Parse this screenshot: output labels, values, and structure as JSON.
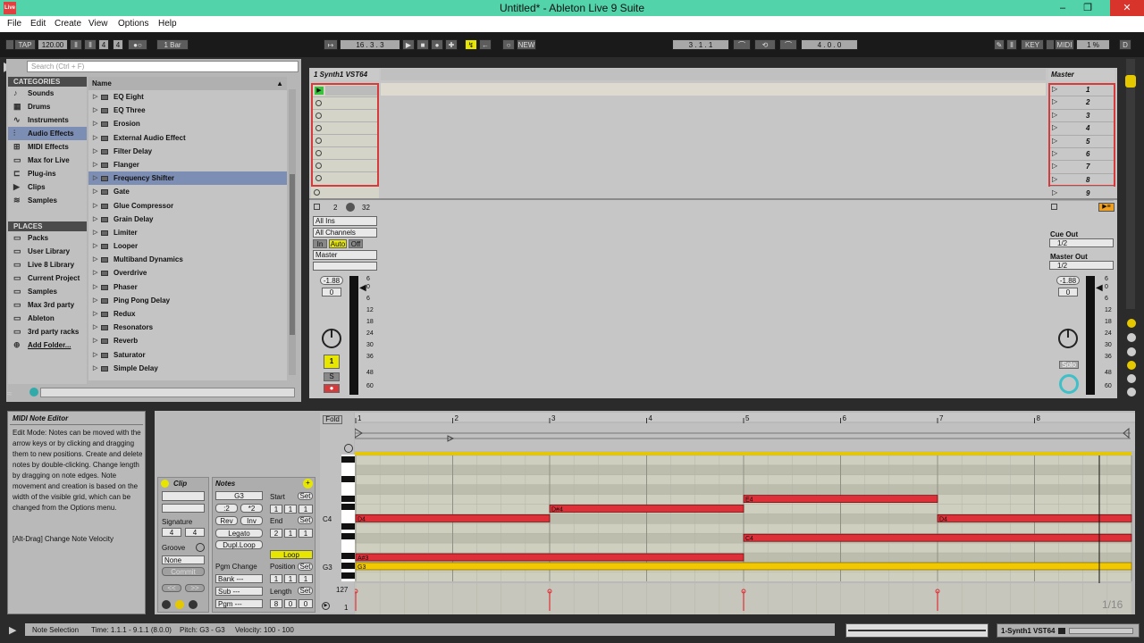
{
  "window": {
    "title": "Untitled* - Ableton Live 9 Suite",
    "icon_text": "Live"
  },
  "menu": [
    "File",
    "Edit",
    "Create",
    "View",
    "Options",
    "Help"
  ],
  "toolbar": {
    "tap": "TAP",
    "tempo": "120.00",
    "sig_num": "4",
    "sig_den": "4",
    "quant": "1 Bar",
    "position": "16 . 3 . 3",
    "new": "NEW",
    "loop_start": "3 . 1 . 1",
    "loop_len": "4 . 0 . 0",
    "key": "KEY",
    "midi": "MIDI",
    "cpu": "1 %",
    "d": "D"
  },
  "browser": {
    "search_placeholder": "Search (Ctrl + F)",
    "categories_title": "CATEGORIES",
    "categories": [
      "Sounds",
      "Drums",
      "Instruments",
      "Audio Effects",
      "MIDI Effects",
      "Max for Live",
      "Plug-ins",
      "Clips",
      "Samples"
    ],
    "places_title": "PLACES",
    "places": [
      "Packs",
      "User Library",
      "Live 8 Library",
      "Current Project",
      "Samples",
      "Max 3rd party",
      "Ableton",
      "3rd party racks",
      "Add Folder..."
    ],
    "name_header": "Name",
    "items": [
      "EQ Eight",
      "EQ Three",
      "Erosion",
      "External Audio Effect",
      "Filter Delay",
      "Flanger",
      "Frequency Shifter",
      "Gate",
      "Glue Compressor",
      "Grain Delay",
      "Limiter",
      "Looper",
      "Multiband Dynamics",
      "Overdrive",
      "Phaser",
      "Ping Pong Delay",
      "Redux",
      "Resonators",
      "Reverb",
      "Saturator",
      "Simple Delay"
    ]
  },
  "track": {
    "name": "1 Synth1 VST64",
    "num_a": "2",
    "num_b": "32",
    "input_type": "All Ins",
    "input_channel": "All Channels",
    "mon_in": "In",
    "mon_auto": "Auto",
    "mon_off": "Off",
    "output": "Master",
    "volume": "-1.88",
    "pan": "0",
    "track_num": "1",
    "solo": "S"
  },
  "master": {
    "name": "Master",
    "scenes": [
      "1",
      "2",
      "3",
      "4",
      "5",
      "6",
      "7",
      "8",
      "9"
    ],
    "cue_out_label": "Cue Out",
    "cue_out": "1/2",
    "master_out_label": "Master Out",
    "master_out": "1/2",
    "volume": "-1.88",
    "pan": "0",
    "solo": "Solo"
  },
  "meter_scale": [
    "6",
    "0",
    "6",
    "12",
    "18",
    "24",
    "30",
    "36",
    "48",
    "60"
  ],
  "info": {
    "title": "MIDI Note Editor",
    "text": "Edit Mode: Notes can be moved with the arrow keys or by clicking and dragging them to new positions. Create and delete notes by double-clicking. Change length by dragging on note edges. Note movement and creation is based on the width of the visible grid, which can be changed from the Options menu.",
    "hint": "[Alt-Drag] Change Note Velocity"
  },
  "clip": {
    "title": "Clip",
    "signature_label": "Signature",
    "sig_num": "4",
    "sig_den": "4",
    "groove_label": "Groove",
    "groove": "None",
    "commit": "Commit"
  },
  "notes": {
    "title": "Notes",
    "note_name": "G3",
    "half": ":2",
    "double": "*2",
    "rev": "Rev",
    "inv": "Inv",
    "legato": "Legato",
    "dupl": "Dupl.Loop",
    "pgm_change": "Pgm Change",
    "bank": "Bank ---",
    "sub": "Sub ---",
    "pgm": "Pgm ---",
    "start_label": "Start",
    "start": [
      "1",
      "1",
      "1"
    ],
    "end_label": "End",
    "end": [
      "2",
      "1",
      "1"
    ],
    "loop": "Loop",
    "position_label": "Position",
    "position": [
      "1",
      "1",
      "1"
    ],
    "length_label": "Length",
    "length": [
      "8",
      "0",
      "0"
    ],
    "set": "Set"
  },
  "editor": {
    "fold": "Fold",
    "bars": [
      "1",
      "2",
      "3",
      "4",
      "5",
      "6",
      "7",
      "8"
    ],
    "grid": "1/16",
    "vel_max": "127",
    "vel_min": "1",
    "key_labels": [
      "C4",
      "G3"
    ],
    "notes": [
      {
        "name": "E4",
        "start": 5,
        "end": 7
      },
      {
        "name": "D#4",
        "start": 3,
        "end": 5
      },
      {
        "name": "D4",
        "start": 1,
        "end": 3
      },
      {
        "name": "D4",
        "start": 7,
        "end": 9
      },
      {
        "name": "C4",
        "start": 5,
        "end": 9
      },
      {
        "name": "A#3",
        "start": 1,
        "end": 5
      },
      {
        "name": "G3",
        "start": 1,
        "end": 9
      }
    ]
  },
  "status": {
    "mode": "Note Selection",
    "time": "Time: 1.1.1 - 9.1.1 (8.0.0)",
    "pitch": "Pitch: G3 - G3",
    "velocity": "Velocity: 100 - 100",
    "track": "1-Synth1 VST64"
  }
}
